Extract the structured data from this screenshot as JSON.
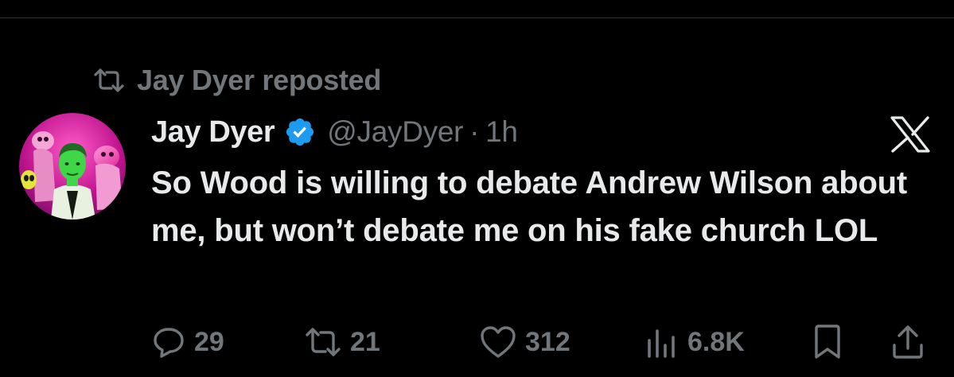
{
  "repost": {
    "label": "Jay Dyer reposted"
  },
  "tweet": {
    "display_name": "Jay Dyer",
    "handle": "@JayDyer",
    "separator": "·",
    "time": "1h",
    "text": "So Wood is willing to debate Andrew Wilson about me, but won’t debate me on his fake church LOL",
    "verified": true
  },
  "actions": {
    "replies": "29",
    "reposts": "21",
    "likes": "312",
    "views": "6.8K"
  },
  "icons": {
    "repost_indicator": "repost-icon",
    "verified": "verified-badge-icon",
    "brand": "x-logo-icon",
    "reply": "reply-icon",
    "repost": "repost-icon",
    "like": "heart-icon",
    "views": "analytics-icon",
    "bookmark": "bookmark-icon",
    "share": "share-icon"
  },
  "colors": {
    "background": "#000000",
    "primary_text": "#e7e9ea",
    "secondary_text": "#71767b",
    "verified_blue": "#1d9bf0",
    "divider": "#2f3336"
  }
}
